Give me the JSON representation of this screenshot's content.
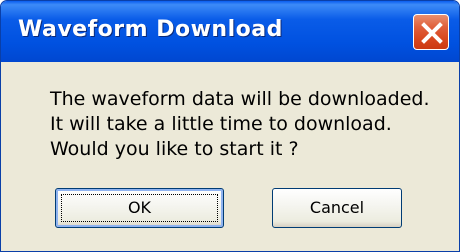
{
  "window": {
    "title": "Waveform Download",
    "close_icon": "close-icon"
  },
  "dialog": {
    "message_lines": [
      "The waveform data will be downloaded.",
      "It will take a little time to download.",
      "Would you like to start it ?"
    ]
  },
  "buttons": {
    "ok_label": "OK",
    "cancel_label": "Cancel"
  },
  "colors": {
    "titlebar": "#0054e3",
    "close_button": "#d8471f",
    "dialog_background": "#ece9d8"
  }
}
